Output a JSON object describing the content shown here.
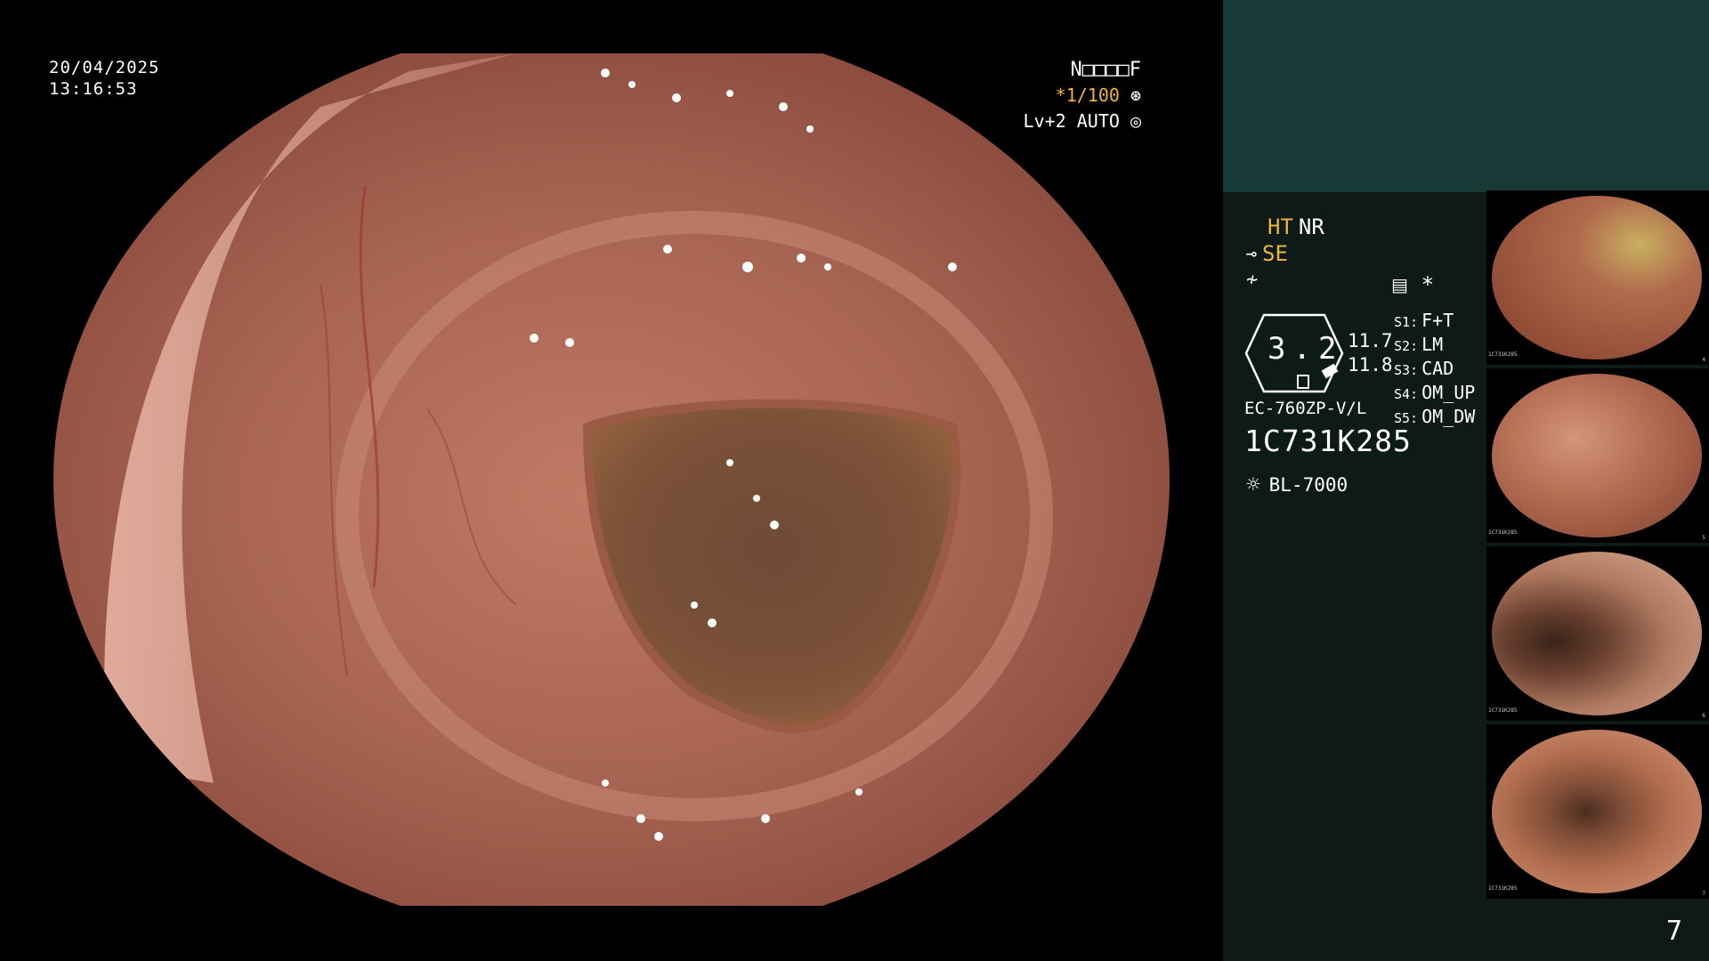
{
  "overlay": {
    "date": "20/04/2025",
    "time": "13:16:53",
    "name_field": "N□□□□F",
    "shutter": "*1/100",
    "level": "Lv+2 AUTO"
  },
  "panel": {
    "ht": "HT",
    "nr": "NR",
    "se": "SE",
    "gauge_value": "3.2",
    "gauge_sub1": "11.7",
    "gauge_sub2": "11.8",
    "scope_model": "EC-760ZP-V/L",
    "serial": "1C731K285",
    "light_source": "BL-7000",
    "star": "*",
    "slots": [
      {
        "key": "S1:",
        "value": "F+T"
      },
      {
        "key": "S2:",
        "value": "LM"
      },
      {
        "key": "S3:",
        "value": "CAD"
      },
      {
        "key": "S4:",
        "value": "OM_UP"
      },
      {
        "key": "S5:",
        "value": "OM_DW"
      }
    ],
    "page_number": "7"
  },
  "thumbnails": [
    {
      "label": "1C731K285",
      "num": "4"
    },
    {
      "label": "1C731K285",
      "num": "5"
    },
    {
      "label": "1C731K285",
      "num": "6"
    },
    {
      "label": "1C731K285",
      "num": "7"
    }
  ],
  "icons": [
    "cross-wheel-icon",
    "auto-ring-icon",
    "scope-sensor-icon",
    "sub-icon",
    "memo-icon",
    "sun-icon"
  ],
  "colors": {
    "accent_orange": "#f0b33a",
    "panel_top": "#183a36",
    "panel_bg": "#0d1a17"
  }
}
